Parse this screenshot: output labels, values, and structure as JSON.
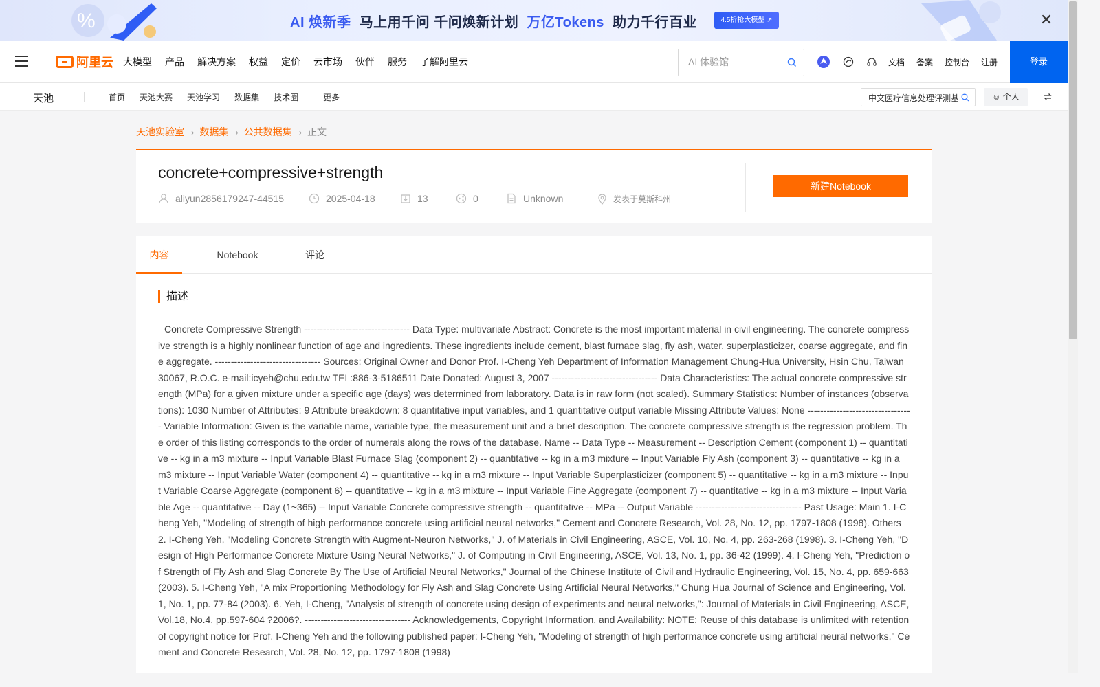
{
  "promo": {
    "ai_prefix": "AI",
    "season": "焕新季",
    "headline": "马上用千问  千问焕新计划",
    "tokens": "万亿Tokens",
    "tail": "助力千行百业",
    "pill_label": "4.5折抢大模型 ↗",
    "close_label": "✕"
  },
  "header": {
    "logo_text": "阿里云",
    "nav": [
      "大模型",
      "产品",
      "解决方案",
      "权益",
      "定价",
      "云市场",
      "伙伴",
      "服务",
      "了解阿里云"
    ],
    "search_placeholder": "AI 体验馆",
    "links": [
      "文档",
      "备案",
      "控制台",
      "注册"
    ],
    "login_label": "登录"
  },
  "subnav": {
    "brand": "天池",
    "links": [
      "首页",
      "天池大赛",
      "天池学习",
      "数据集",
      "技术圈"
    ],
    "more": "更多",
    "search_value": "中文医疗信息处理评测基",
    "personal_label": "个人"
  },
  "breadcrumb": [
    "天池实验室",
    "数据集",
    "公共数据集",
    "正文"
  ],
  "dataset": {
    "title": "concrete+compressive+strength",
    "author": "aliyun2856179247-44515",
    "date": "2025-04-18",
    "downloads": "13",
    "shares": "0",
    "license": "Unknown",
    "location": "发表于莫斯科州",
    "new_notebook_label": "新建Notebook"
  },
  "tabs": [
    "内容",
    "Notebook",
    "评论"
  ],
  "active_tab": "内容",
  "section_title": "描述",
  "description": "Concrete Compressive Strength --------------------------------- Data Type: multivariate Abstract: Concrete is the most important material in civil engineering. The concrete compressive strength is a highly nonlinear function of age and ingredients. These ingredients include cement, blast furnace slag, fly ash, water, superplasticizer, coarse aggregate, and fine aggregate. --------------------------------- Sources: Original Owner and Donor Prof. I-Cheng Yeh Department of Information Management Chung-Hua University, Hsin Chu, Taiwan 30067, R.O.C. e-mail:icyeh@chu.edu.tw TEL:886-3-5186511 Date Donated: August 3, 2007 --------------------------------- Data Characteristics: The actual concrete compressive strength (MPa) for a given mixture under a specific age (days) was determined from laboratory. Data is in raw form (not scaled). Summary Statistics: Number of instances (observations): 1030 Number of Attributes: 9 Attribute breakdown: 8 quantitative input variables, and 1 quantitative output variable Missing Attribute Values: None --------------------------------- Variable Information: Given is the variable name, variable type, the measurement unit and a brief description. The concrete compressive strength is the regression problem. The order of this listing corresponds to the order of numerals along the rows of the database. Name -- Data Type -- Measurement -- Description Cement (component 1) -- quantitative -- kg in a m3 mixture -- Input Variable Blast Furnace Slag (component 2) -- quantitative -- kg in a m3 mixture -- Input Variable Fly Ash (component 3) -- quantitative -- kg in a m3 mixture -- Input Variable Water (component 4) -- quantitative -- kg in a m3 mixture -- Input Variable Superplasticizer (component 5) -- quantitative -- kg in a m3 mixture -- Input Variable Coarse Aggregate (component 6) -- quantitative -- kg in a m3 mixture -- Input Variable Fine Aggregate (component 7) -- quantitative -- kg in a m3 mixture -- Input Variable Age -- quantitative -- Day (1~365) -- Input Variable Concrete compressive strength -- quantitative -- MPa -- Output Variable --------------------------------- Past Usage: Main 1. I-Cheng Yeh, \"Modeling of strength of high performance concrete using artificial neural networks,\" Cement and Concrete Research, Vol. 28, No. 12, pp. 1797-1808 (1998). Others 2. I-Cheng Yeh, \"Modeling Concrete Strength with Augment-Neuron Networks,\" J. of Materials in Civil Engineering, ASCE, Vol. 10, No. 4, pp. 263-268 (1998). 3. I-Cheng Yeh, \"Design of High Performance Concrete Mixture Using Neural Networks,\" J. of Computing in Civil Engineering, ASCE, Vol. 13, No. 1, pp. 36-42 (1999). 4. I-Cheng Yeh, \"Prediction of Strength of Fly Ash and Slag Concrete By The Use of Artificial Neural Networks,\" Journal of the Chinese Institute of Civil and Hydraulic Engineering, Vol. 15, No. 4, pp. 659-663 (2003). 5. I-Cheng Yeh, \"A mix Proportioning Methodology for Fly Ash and Slag Concrete Using Artificial Neural Networks,\" Chung Hua Journal of Science and Engineering, Vol. 1, No. 1, pp. 77-84 (2003). 6. Yeh, I-Cheng, \"Analysis of strength of concrete using design of experiments and neural networks,\": Journal of Materials in Civil Engineering, ASCE, Vol.18, No.4, pp.597-604 ?2006?. --------------------------------- Acknowledgements, Copyright Information, and Availability: NOTE: Reuse of this database is unlimited with retention of copyright notice for Prof. I-Cheng Yeh and the following published paper: I-Cheng Yeh, \"Modeling of strength of high performance concrete using artificial neural networks,\" Cement and Concrete Research, Vol. 28, No. 12, pp. 1797-1808 (1998)",
  "colors": {
    "accent": "#ff6a00",
    "login_blue": "#0064f0",
    "promo_blue": "#3a5bf0"
  },
  "icons": [
    "menu-icon",
    "search-icon",
    "assistant-icon",
    "ai-icon",
    "headset-icon",
    "user-icon",
    "clock-icon",
    "download-icon",
    "share-icon",
    "file-icon",
    "location-icon",
    "switch-icon",
    "chevron-right-icon"
  ]
}
